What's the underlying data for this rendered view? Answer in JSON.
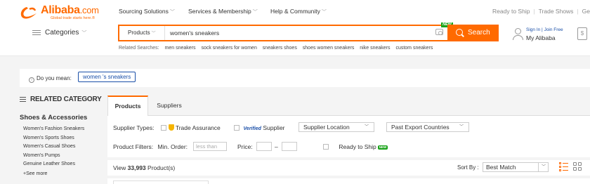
{
  "logo": {
    "text": "Alibaba",
    "suffix": ".com",
    "tagline": "Global trade starts here.®"
  },
  "header_nav": [
    {
      "label": "Sourcing Solutions"
    },
    {
      "label": "Services & Membership"
    },
    {
      "label": "Help & Community"
    }
  ],
  "top_links": [
    "Ready to Ship",
    "Trade Shows",
    "Ge"
  ],
  "categories_label": "Categories",
  "search": {
    "type_label": "Products",
    "query": "women's sneakers",
    "new_badge": "NEW",
    "button_label": "Search"
  },
  "related_searches": {
    "label": "Related Searches:",
    "items": [
      "men sneakers",
      "sock sneakers for women",
      "sneakers shoes",
      "shoes women sneakers",
      "nike sneakers",
      "custom sneakers"
    ]
  },
  "account": {
    "sign_in": "Sign In",
    "join_free": "Join Free",
    "my_alibaba": "My Alibaba"
  },
  "did_you_mean": {
    "label": "Do you mean:",
    "suggestion": "women 's sneakers"
  },
  "sidebar": {
    "heading": "RELATED CATEGORY",
    "category": "Shoes & Accessories",
    "subcategories": [
      "Women's Fashion Sneakers",
      "Women's Sports Shoes",
      "Women's Casual Shoes",
      "Women's Pumps",
      "Genuine Leather Shoes"
    ],
    "see_more": "See more"
  },
  "tabs": [
    {
      "label": "Products"
    },
    {
      "label": "Suppliers"
    }
  ],
  "filters": {
    "supplier_types_label": "Supplier Types:",
    "trade_assurance": "Trade Assurance",
    "verified": "Verified",
    "verified_supplier": "Supplier",
    "supplier_location": "Supplier Location",
    "past_export": "Past Export Countries",
    "product_filters_label": "Product Filters:",
    "min_order_label": "Min. Order:",
    "min_order_placeholder": "less than",
    "price_label": "Price:",
    "price_sep": "–",
    "ready_to_ship": "Ready to Ship",
    "new_tag": "NEW"
  },
  "results": {
    "view_prefix": "View",
    "count": "33,993",
    "suffix": "Product(s)"
  },
  "sort": {
    "label": "Sort By :",
    "value": "Best Match"
  },
  "colors": {
    "accent": "#ff6a00",
    "link": "#1a4fa8",
    "new_green": "#1aa31a"
  }
}
